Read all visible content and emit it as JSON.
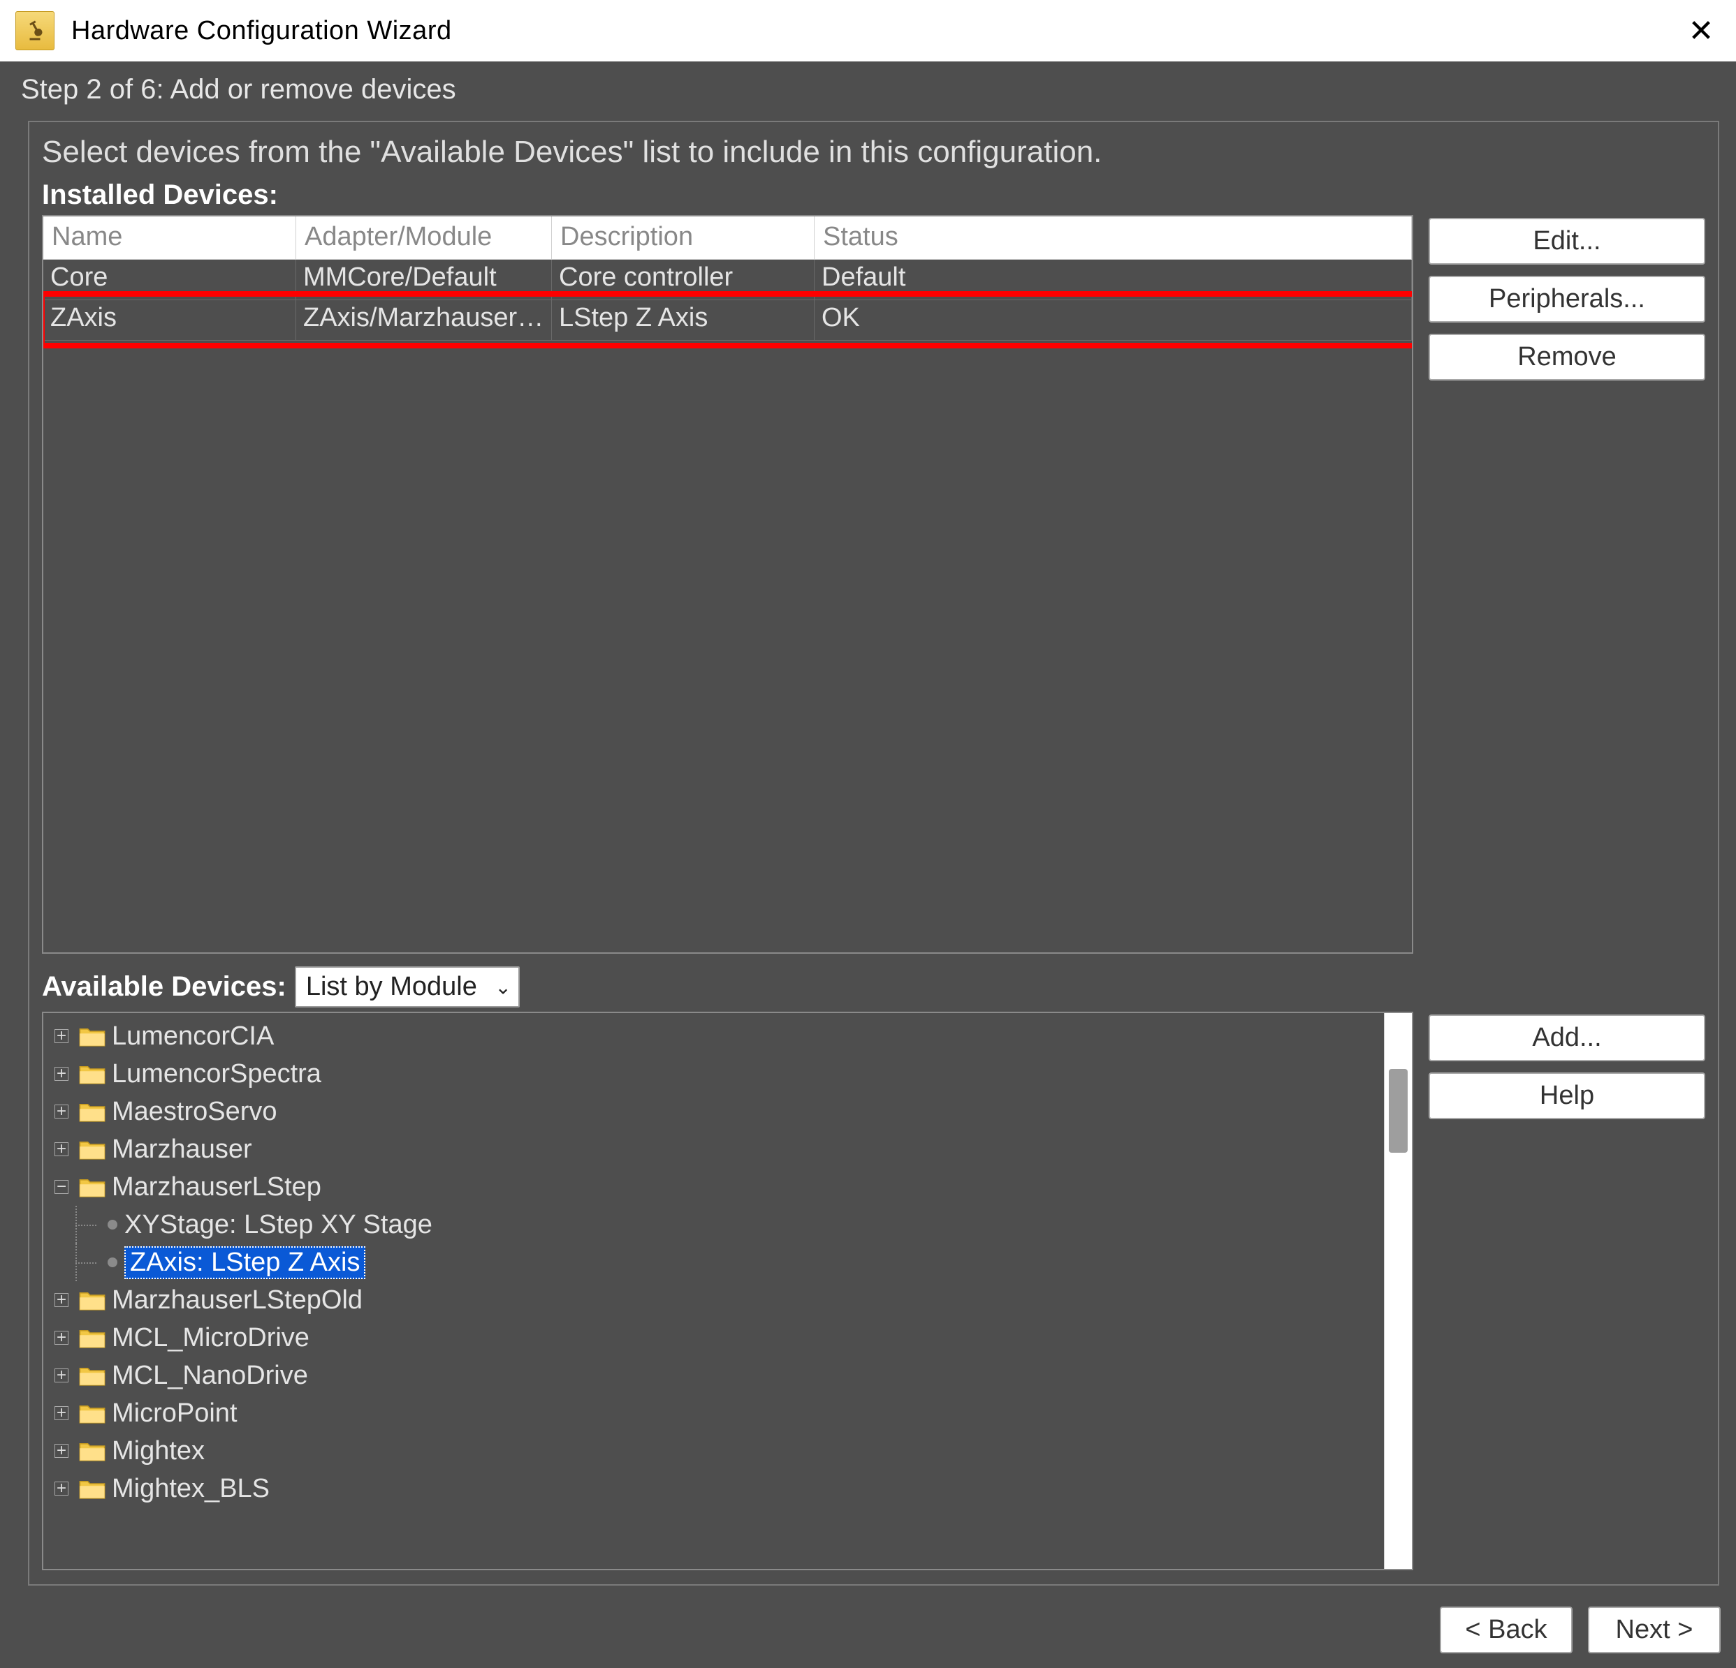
{
  "window": {
    "title": "Hardware Configuration Wizard"
  },
  "step_banner": "Step 2 of 6: Add or remove devices",
  "instruction": "Select devices from the \"Available Devices\" list to include in this configuration.",
  "installed": {
    "label": "Installed Devices:",
    "headers": {
      "name": "Name",
      "adapter": "Adapter/Module",
      "description": "Description",
      "status": "Status"
    },
    "rows": [
      {
        "name": "Core",
        "adapter": "MMCore/Default",
        "description": "Core controller",
        "status": "Default"
      },
      {
        "name": "ZAxis",
        "adapter": "ZAxis/MarzhauserL...",
        "description": "LStep Z Axis",
        "status": "OK"
      }
    ]
  },
  "buttons": {
    "edit": "Edit...",
    "peripherals": "Peripherals...",
    "remove": "Remove",
    "add": "Add...",
    "help": "Help",
    "back": "< Back",
    "next": "Next >"
  },
  "available": {
    "label": "Available Devices:",
    "dropdown": "List by Module",
    "nodes": [
      {
        "label": "LumencorCIA",
        "expandable": true,
        "expanded": false
      },
      {
        "label": "LumencorSpectra",
        "expandable": true,
        "expanded": false
      },
      {
        "label": "MaestroServo",
        "expandable": true,
        "expanded": false
      },
      {
        "label": "Marzhauser",
        "expandable": true,
        "expanded": false
      },
      {
        "label": "MarzhauserLStep",
        "expandable": true,
        "expanded": true,
        "children": [
          {
            "label": "XYStage: LStep XY Stage",
            "selected": false
          },
          {
            "label": "ZAxis: LStep Z Axis",
            "selected": true
          }
        ]
      },
      {
        "label": "MarzhauserLStepOld",
        "expandable": true,
        "expanded": false
      },
      {
        "label": "MCL_MicroDrive",
        "expandable": true,
        "expanded": false
      },
      {
        "label": "MCL_NanoDrive",
        "expandable": true,
        "expanded": false
      },
      {
        "label": "MicroPoint",
        "expandable": true,
        "expanded": false
      },
      {
        "label": "Mightex",
        "expandable": true,
        "expanded": false
      },
      {
        "label": "Mightex_BLS",
        "expandable": true,
        "expanded": false
      }
    ]
  }
}
